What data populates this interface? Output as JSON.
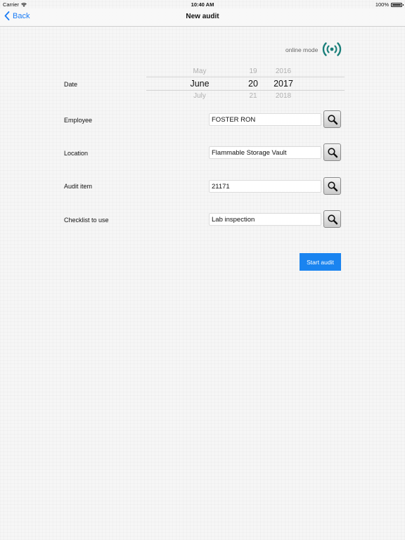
{
  "status_bar": {
    "carrier": "Carrier",
    "time": "10:40 AM",
    "battery": "100%"
  },
  "nav": {
    "back_label": "Back",
    "title": "New audit"
  },
  "connection": {
    "label": "online mode",
    "color": "#1a7f7a"
  },
  "form": {
    "date": {
      "label": "Date",
      "month": {
        "prev": "May",
        "selected": "June",
        "next": "July"
      },
      "day": {
        "prev": "19",
        "selected": "20",
        "next": "21"
      },
      "year": {
        "prev": "2016",
        "selected": "2017",
        "next": "2018"
      }
    },
    "employee": {
      "label": "Employee",
      "value": "FOSTER RON"
    },
    "location": {
      "label": "Location",
      "value": "Flammable Storage Vault"
    },
    "audit_item": {
      "label": "Audit item",
      "value": "21171"
    },
    "checklist": {
      "label": "Checklist to use",
      "value": "Lab inspection"
    }
  },
  "actions": {
    "start_label": "Start audit"
  },
  "colors": {
    "accent": "#1a7cf5",
    "button": "#1a84f0"
  }
}
